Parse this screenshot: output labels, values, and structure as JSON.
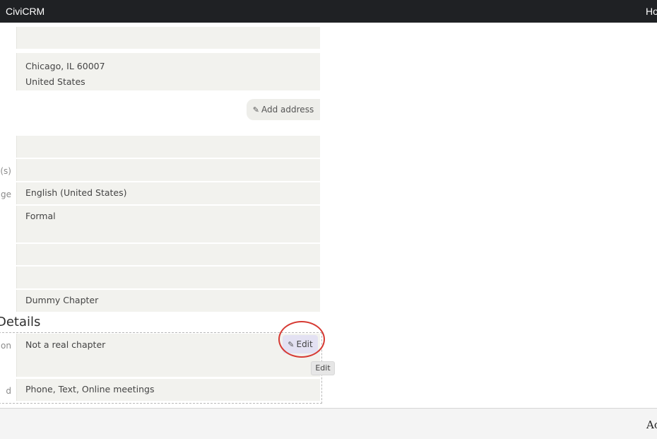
{
  "topbar": {
    "brand": "CiviCRM",
    "home_link": "Ho"
  },
  "address": {
    "line1": "Chicago, IL 60007",
    "line2": "United States",
    "add_label": "Add address"
  },
  "fields": {
    "label_s": "(s)",
    "label_ge": "ge",
    "language": "English (United States)",
    "greeting": "Formal",
    "chapter": "Dummy Chapter"
  },
  "details": {
    "title": "Details",
    "label_on": "on",
    "description": "Not a real chapter",
    "label_d": "d",
    "methods": "Phone, Text, Online meetings",
    "edit_label": "Edit",
    "tooltip": "Edit"
  },
  "bottombar": {
    "text": "Ac"
  },
  "colors": {
    "topbar": "#1f2124",
    "row_bg": "#f2f2ee",
    "edit_bg": "#e3e1f2",
    "highlight": "#d63a33"
  },
  "icons": {
    "pencil": "pencil-icon"
  }
}
